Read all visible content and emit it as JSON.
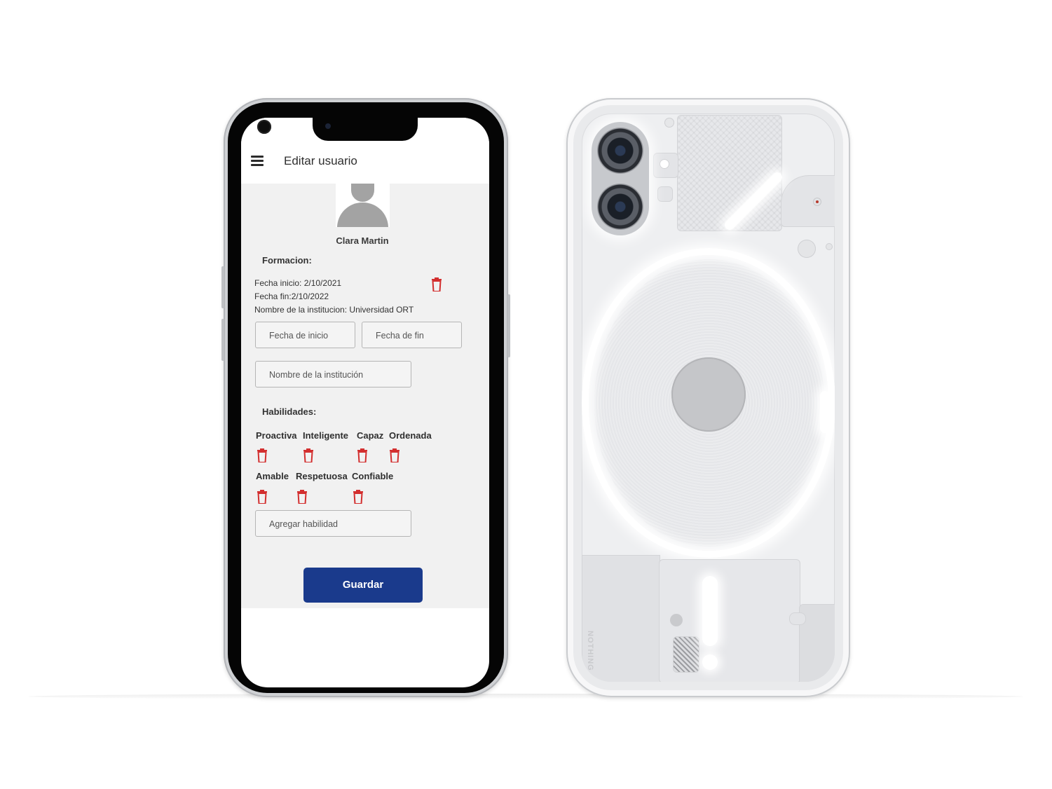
{
  "app": {
    "title": "Editar usuario",
    "menu_icon": "hamburger-menu-icon"
  },
  "profile": {
    "avatar_icon": "user-avatar-icon",
    "name": "Clara Martin"
  },
  "formacion": {
    "section_title": "Formacion:",
    "entry": {
      "fecha_inicio": "Fecha inicio: 2/10/2021",
      "fecha_fin": "Fecha fin:2/10/2022",
      "institucion": "Nombre de la institucion: Universidad ORT",
      "delete_icon": "trash-icon"
    },
    "fields": {
      "fecha_inicio_placeholder": "Fecha de inicio",
      "fecha_fin_placeholder": "Fecha de fin",
      "institucion_placeholder": "Nombre de la institución"
    }
  },
  "habilidades": {
    "section_title": "Habilidades:",
    "skills": [
      "Proactiva",
      "Inteligente",
      "Capaz",
      "Ordenada",
      "Amable",
      "Respetuosa",
      "Confiable"
    ],
    "delete_icon": "trash-icon",
    "add_placeholder": "Agregar habilidad"
  },
  "actions": {
    "save_label": "Guardar"
  },
  "colors": {
    "primary_button": "#1a3a8c",
    "delete_icon": "#d32f2f",
    "content_background": "#f1f1f1"
  },
  "device_back": {
    "brand": "NOTHING"
  }
}
